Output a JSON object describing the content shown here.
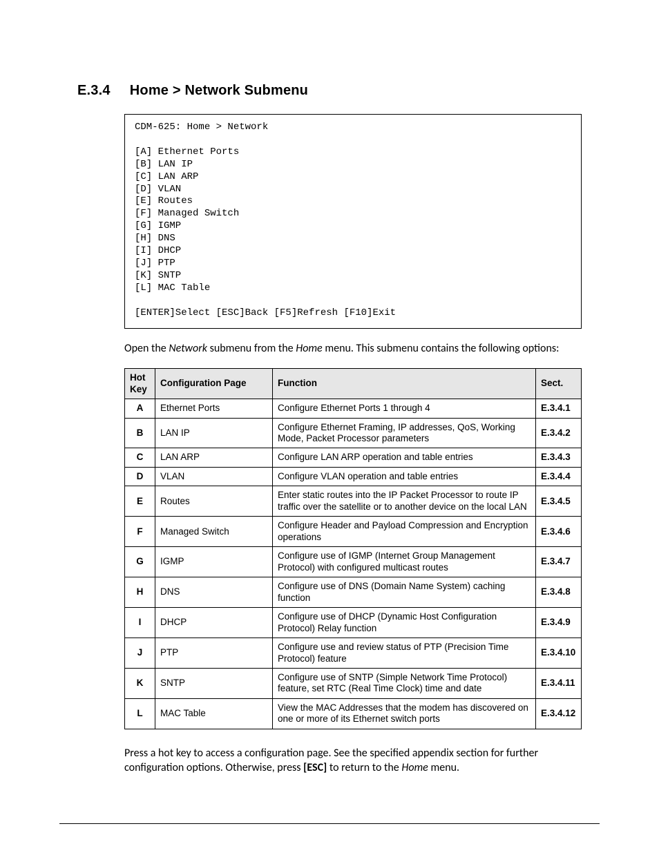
{
  "heading": {
    "number": "E.3.4",
    "title": "Home > Network Submenu"
  },
  "terminal": {
    "title_line": "CDM-625: Home > Network",
    "items": [
      {
        "key": "[A]",
        "label": "Ethernet Ports"
      },
      {
        "key": "[B]",
        "label": "LAN IP"
      },
      {
        "key": "[C]",
        "label": "LAN ARP"
      },
      {
        "key": "[D]",
        "label": "VLAN"
      },
      {
        "key": "[E]",
        "label": "Routes"
      },
      {
        "key": "[F]",
        "label": "Managed Switch"
      },
      {
        "key": "[G]",
        "label": "IGMP"
      },
      {
        "key": "[H]",
        "label": "DNS"
      },
      {
        "key": "[I]",
        "label": "DHCP"
      },
      {
        "key": "[J]",
        "label": "PTP"
      },
      {
        "key": "[K]",
        "label": "SNTP"
      },
      {
        "key": "[L]",
        "label": "MAC Table"
      }
    ],
    "footer_line": "[ENTER]Select [ESC]Back [F5]Refresh [F10]Exit"
  },
  "intro": {
    "pre": "Open the ",
    "em1": "Network",
    "mid": " submenu from the ",
    "em2": "Home",
    "post": " menu. This submenu contains the following options:"
  },
  "table": {
    "headers": {
      "key": "Hot Key",
      "page": "Configuration Page",
      "func": "Function",
      "sect": "Sect."
    },
    "rows": [
      {
        "key": "A",
        "page": "Ethernet Ports",
        "func": "Configure Ethernet Ports 1 through 4",
        "sect": "E.3.4.1"
      },
      {
        "key": "B",
        "page": "LAN IP",
        "func": "Configure Ethernet Framing, IP addresses, QoS, Working Mode, Packet Processor parameters",
        "sect": "E.3.4.2"
      },
      {
        "key": "C",
        "page": "LAN ARP",
        "func": "Configure LAN ARP operation and table entries",
        "sect": "E.3.4.3"
      },
      {
        "key": "D",
        "page": "VLAN",
        "func": "Configure VLAN operation and table entries",
        "sect": "E.3.4.4"
      },
      {
        "key": "E",
        "page": "Routes",
        "func": "Enter static routes into the IP Packet Processor to route IP traffic over the satellite or to another device on the local LAN",
        "sect": "E.3.4.5"
      },
      {
        "key": "F",
        "page": "Managed Switch",
        "func": "Configure Header and Payload Compression and Encryption operations",
        "sect": "E.3.4.6"
      },
      {
        "key": "G",
        "page": "IGMP",
        "func": "Configure use of IGMP (Internet Group Management Protocol) with configured multicast routes",
        "sect": "E.3.4.7"
      },
      {
        "key": "H",
        "page": "DNS",
        "func": "Configure use of DNS (Domain Name System) caching function",
        "sect": "E.3.4.8"
      },
      {
        "key": "I",
        "page": "DHCP",
        "func": "Configure use of DHCP (Dynamic Host Configuration Protocol) Relay function",
        "sect": "E.3.4.9"
      },
      {
        "key": "J",
        "page": "PTP",
        "func": "Configure use and review status of PTP (Precision Time Protocol) feature",
        "sect": "E.3.4.10"
      },
      {
        "key": "K",
        "page": "SNTP",
        "func": "Configure use of SNTP (Simple Network Time Protocol) feature, set RTC (Real Time Clock) time and date",
        "sect": "E.3.4.11"
      },
      {
        "key": "L",
        "page": "MAC Table",
        "func": "View the MAC Addresses that the modem has discovered on one or more of its Ethernet switch ports",
        "sect": "E.3.4.12"
      }
    ]
  },
  "outro": {
    "line1": "Press a hot key to access a configuration page. See the specified appendix section for further configuration options. Otherwise, press ",
    "bold": "[ESC]",
    "mid": " to return to the ",
    "em": "Home",
    "post": " menu."
  }
}
